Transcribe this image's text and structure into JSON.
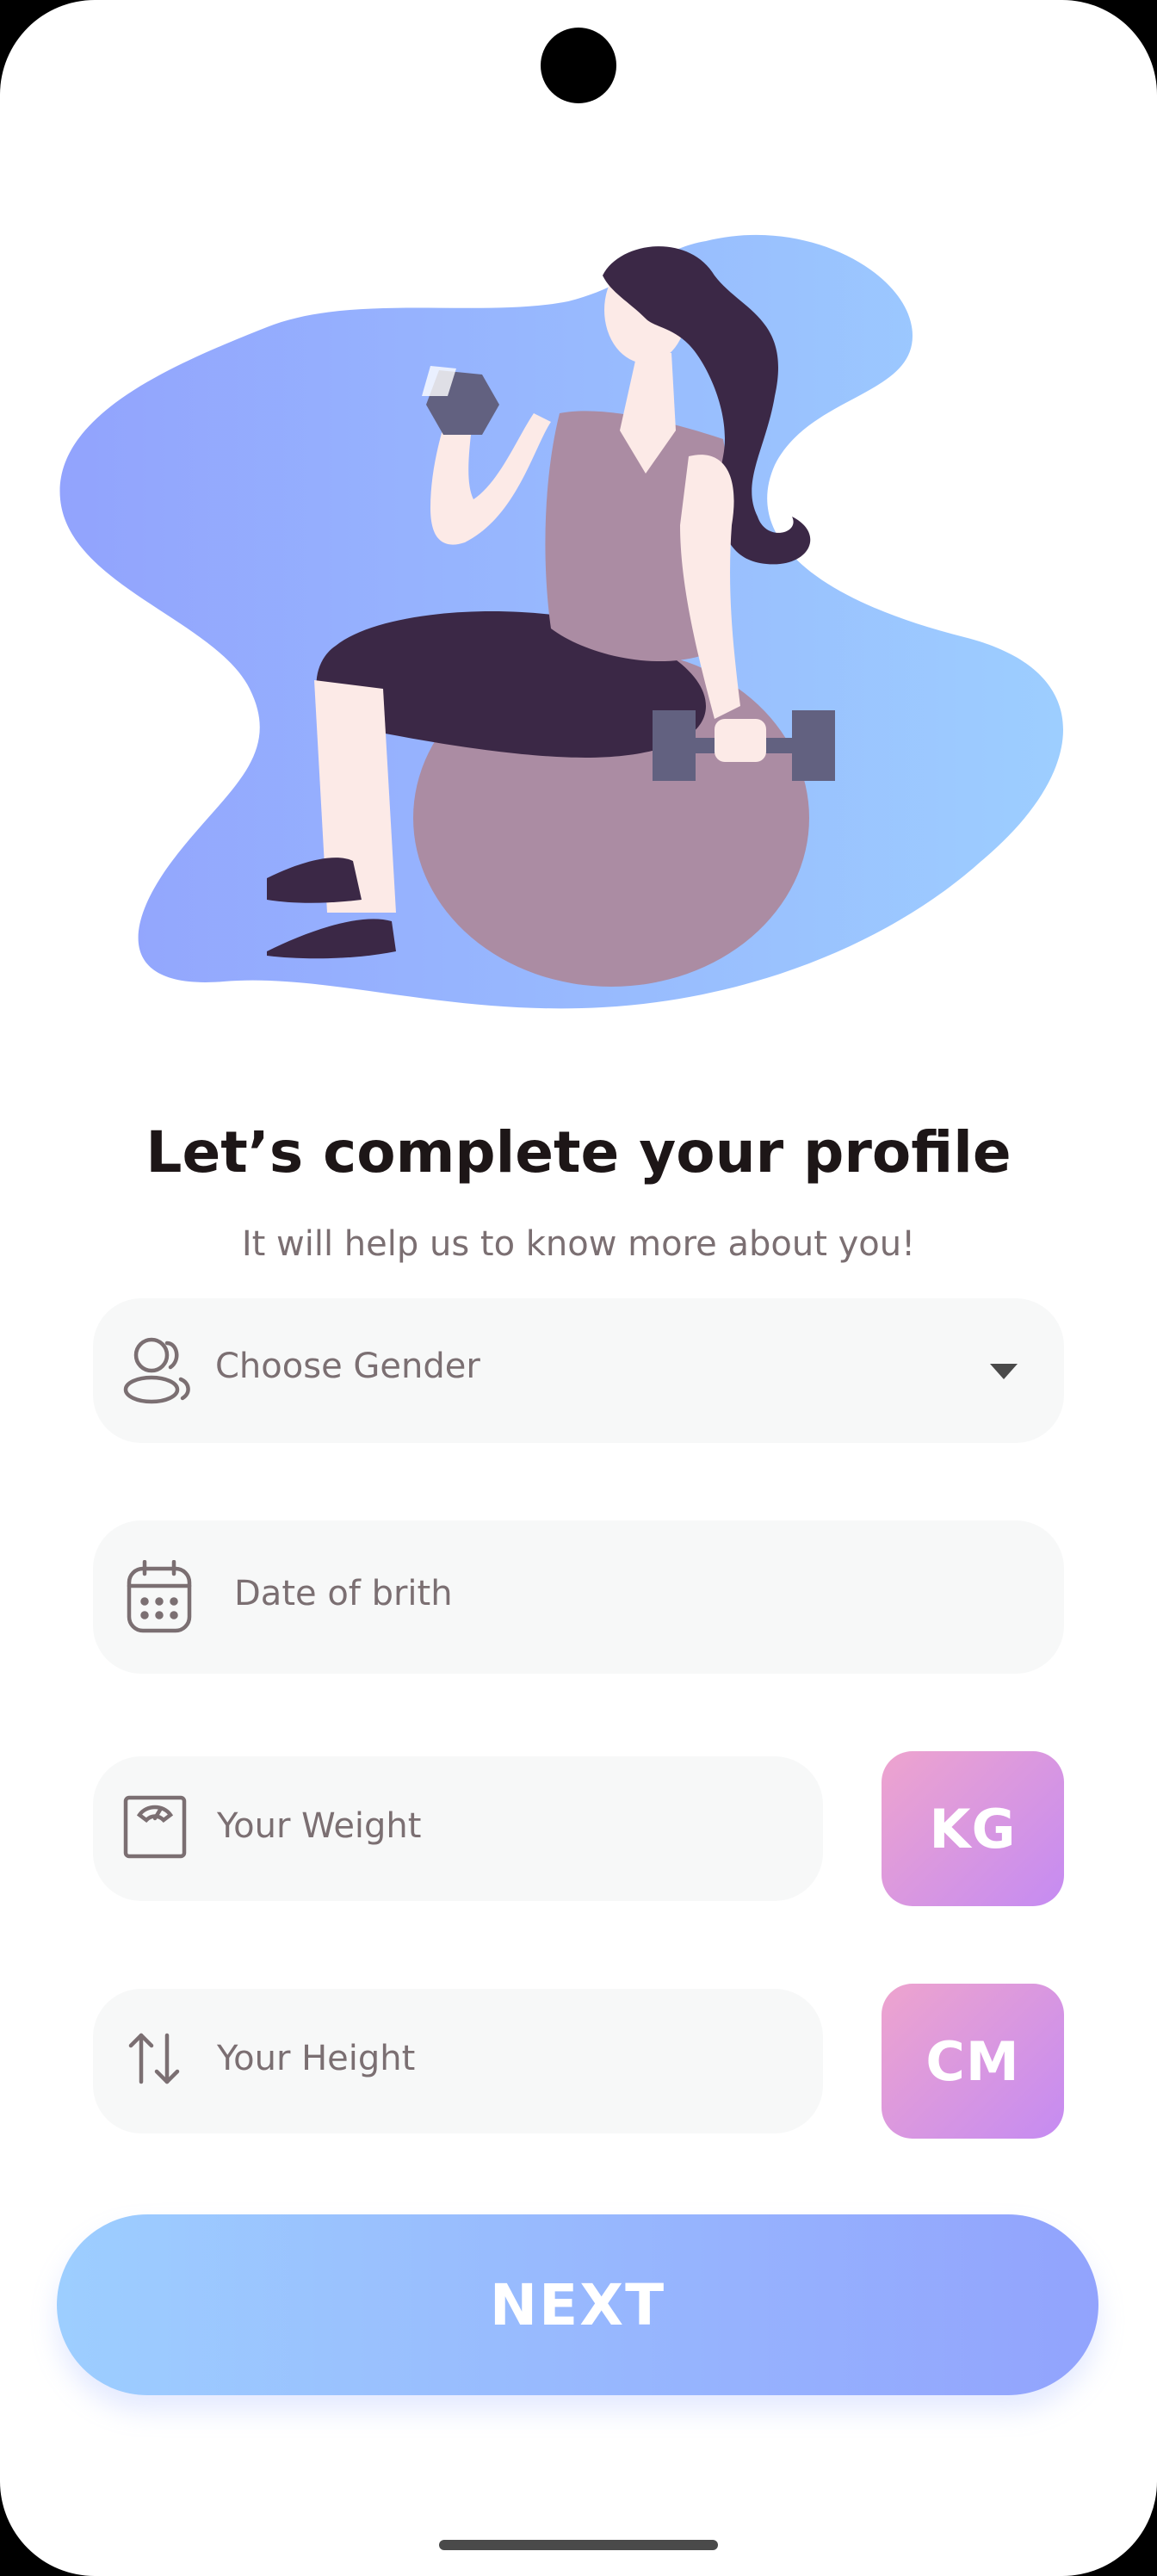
{
  "header": {
    "title": "Let’s complete your profile",
    "subtitle": "It will help us to know more about you!"
  },
  "form": {
    "gender": {
      "placeholder": "Choose Gender",
      "icon": "two-users-icon",
      "dropdown_icon": "caret-down-icon"
    },
    "dob": {
      "placeholder": "Date of brith",
      "icon": "calendar-icon"
    },
    "weight": {
      "placeholder": "Your Weight",
      "icon": "scale-icon",
      "unit": "KG"
    },
    "height": {
      "placeholder": "Your Height",
      "icon": "swap-vertical-icon",
      "unit": "CM"
    }
  },
  "actions": {
    "next_label": "NEXT"
  },
  "colors": {
    "primary_start": "#9DCEFF",
    "primary_end": "#92A3FD",
    "secondary_start": "#EEA4CE",
    "secondary_end": "#C58BF2",
    "field_bg": "#F7F8F8",
    "text_dark": "#1D1617",
    "text_gray": "#7B6F72"
  }
}
